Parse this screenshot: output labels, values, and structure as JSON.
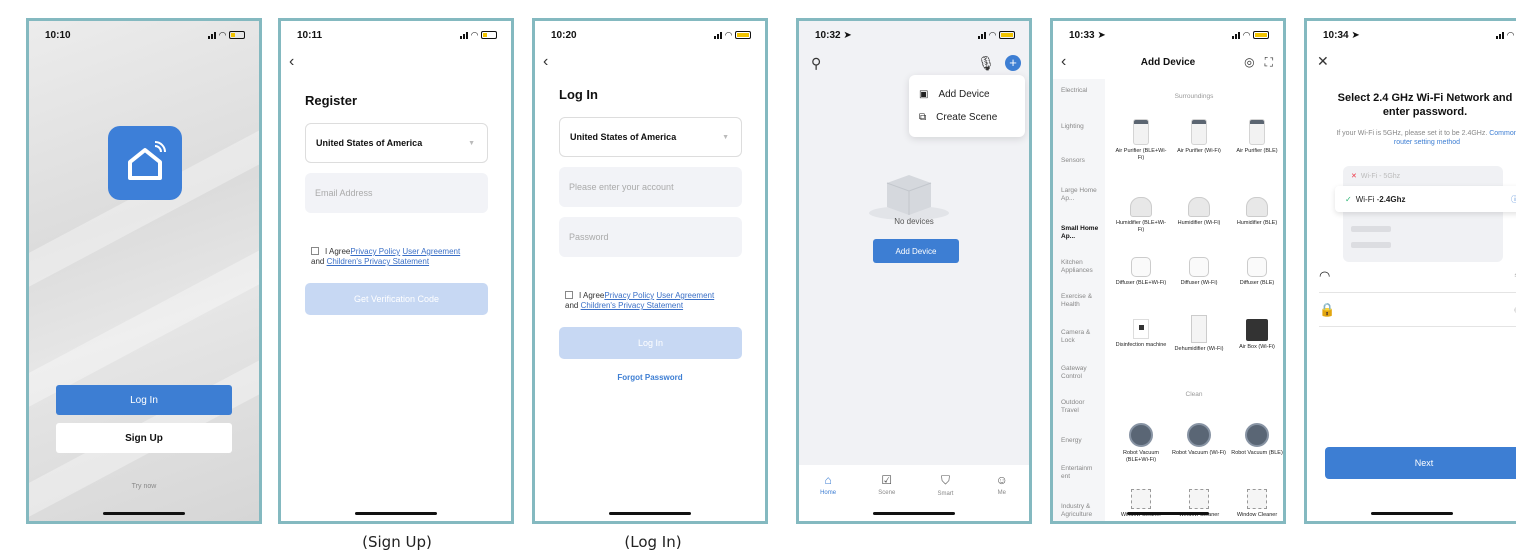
{
  "screens": {
    "splash": {
      "time": "10:10",
      "login_label": "Log In",
      "signup_label": "Sign Up",
      "try_now": "Try now"
    },
    "register": {
      "time": "10:11",
      "title": "Register",
      "country": "United States of America",
      "email_placeholder": "Email Address",
      "agree_prefix": "I Agree",
      "privacy_policy": "Privacy Policy",
      "user_agreement": "User Agreement",
      "and_text": "and",
      "children_privacy": "Children's Privacy Statement",
      "verify_button": "Get Verification Code"
    },
    "login": {
      "time": "10:20",
      "title": "Log In",
      "country": "United States of America",
      "account_placeholder": "Please enter your account",
      "password_placeholder": "Password",
      "agree_prefix": "I Agree",
      "privacy_policy": "Privacy Policy",
      "user_agreement": "User Agreement",
      "and_text": "and",
      "children_privacy": "Children's Privacy Statement",
      "login_button": "Log In",
      "forgot": "Forgot Password"
    },
    "home": {
      "time": "10:32",
      "menu": [
        "Add Device",
        "Create Scene"
      ],
      "no_devices": "No devices",
      "add_device_button": "Add Device",
      "tabs": [
        {
          "label": "Home",
          "icon": "home-icon"
        },
        {
          "label": "Scene",
          "icon": "scene-icon"
        },
        {
          "label": "Smart",
          "icon": "smart-icon"
        },
        {
          "label": "Me",
          "icon": "me-icon"
        }
      ]
    },
    "add_device": {
      "time": "10:33",
      "title": "Add Device",
      "categories": [
        "Electrical",
        "Lighting",
        "Sensors",
        "Large Home Ap...",
        "Small Home Ap...",
        "Kitchen Appliances",
        "Exercise & Health",
        "Camera & Lock",
        "Gateway Control",
        "Outdoor Travel",
        "Energy",
        "Entertainm ent",
        "Industry & Agriculture"
      ],
      "active_category": "Small Home Ap...",
      "sections": [
        "Surroundings",
        "Clean"
      ],
      "devices": [
        [
          "Air Purifier (BLE+Wi-Fi)",
          "Air Purifier (Wi-Fi)",
          "Air Purifier (BLE)"
        ],
        [
          "Humidifier (BLE+Wi-Fi)",
          "Humidifier (Wi-Fi)",
          "Humidifier (BLE)"
        ],
        [
          "Diffuser (BLE+Wi-Fi)",
          "Diffuser (Wi-Fi)",
          "Diffuser (BLE)"
        ],
        [
          "Disinfection machine",
          "Dehumidifier (Wi-Fi)",
          "Air Box (Wi-Fi)"
        ],
        [
          "Robot Vacuum (BLE+Wi-Fi)",
          "Robot Vacuum (Wi-Fi)",
          "Robot Vacuum (BLE)"
        ],
        [
          "Window Cleaner",
          "Window Cleaner",
          "Window Cleaner"
        ]
      ]
    },
    "wifi": {
      "time": "10:34",
      "title": "Select 2.4 GHz Wi-Fi Network and enter password.",
      "subtitle": "If your Wi-Fi is 5GHz, please set it to be 2.4GHz.",
      "subtitle_link": "Common router setting method",
      "wifi_bad": "Wi-Fi - 5Ghz",
      "wifi_good_prefix": "Wi-Fi - ",
      "wifi_good_band": "2.4Ghz",
      "next_button": "Next"
    }
  },
  "captions": {
    "signup": "(Sign Up)",
    "login": "(Log In)"
  },
  "colors": {
    "primary": "#3d7ed3",
    "frame": "#84b9c0",
    "disabled": "#c7d8f3"
  }
}
